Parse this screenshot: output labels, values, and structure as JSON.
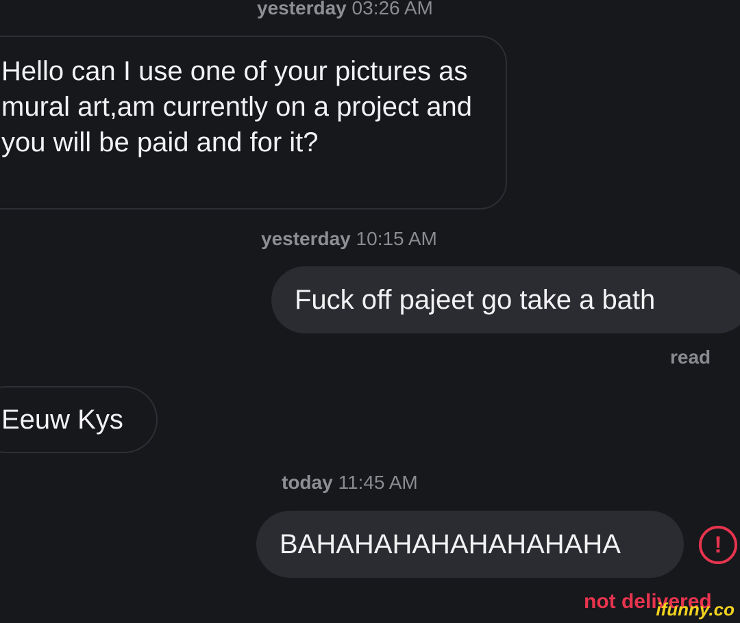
{
  "messages": [
    {
      "day": "yesterday",
      "time": "03:26 AM"
    },
    {
      "text": "Hello can I use one of your pictures as mural art,am currently on a project and you will be paid and for it?"
    },
    {
      "day": "yesterday",
      "time": "10:15 AM"
    },
    {
      "text": "Fuck off pajeet go take a bath",
      "status": "read"
    },
    {
      "text": "Eeuw Kys"
    },
    {
      "day": "today",
      "time": "11:45 AM"
    },
    {
      "text": "BAHAHAHAHAHAHAHAHA",
      "status": "not delivered",
      "error_icon": "exclamation-circle-icon"
    }
  ],
  "watermark": "ifunny.co",
  "colors": {
    "background": "#17181c",
    "outgoing_bubble": "#2b2c31",
    "incoming_border": "#2e2f34",
    "error": "#e8344e",
    "muted_text": "#8a8b90"
  }
}
